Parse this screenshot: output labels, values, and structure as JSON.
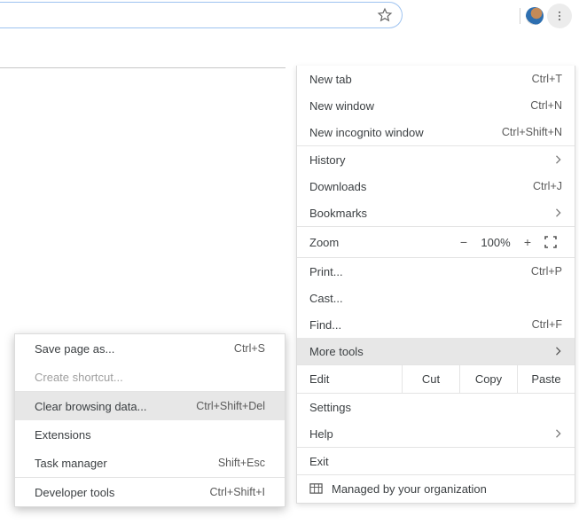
{
  "toolbar": {
    "star_title": "Bookmark this tab"
  },
  "menu": {
    "new_tab": "New tab",
    "new_tab_sc": "Ctrl+T",
    "new_window": "New window",
    "new_window_sc": "Ctrl+N",
    "incognito": "New incognito window",
    "incognito_sc": "Ctrl+Shift+N",
    "history": "History",
    "downloads": "Downloads",
    "downloads_sc": "Ctrl+J",
    "bookmarks": "Bookmarks",
    "zoom_label": "Zoom",
    "zoom_minus": "−",
    "zoom_value": "100%",
    "zoom_plus": "+",
    "print": "Print...",
    "print_sc": "Ctrl+P",
    "cast": "Cast...",
    "find": "Find...",
    "find_sc": "Ctrl+F",
    "more_tools": "More tools",
    "edit": "Edit",
    "cut": "Cut",
    "copy": "Copy",
    "paste": "Paste",
    "settings": "Settings",
    "help": "Help",
    "exit": "Exit",
    "managed": "Managed by your organization"
  },
  "submenu": {
    "save_as": "Save page as...",
    "save_as_sc": "Ctrl+S",
    "create_shortcut": "Create shortcut...",
    "clear_data": "Clear browsing data...",
    "clear_data_sc": "Ctrl+Shift+Del",
    "extensions": "Extensions",
    "task_manager": "Task manager",
    "task_manager_sc": "Shift+Esc",
    "devtools": "Developer tools",
    "devtools_sc": "Ctrl+Shift+I"
  }
}
